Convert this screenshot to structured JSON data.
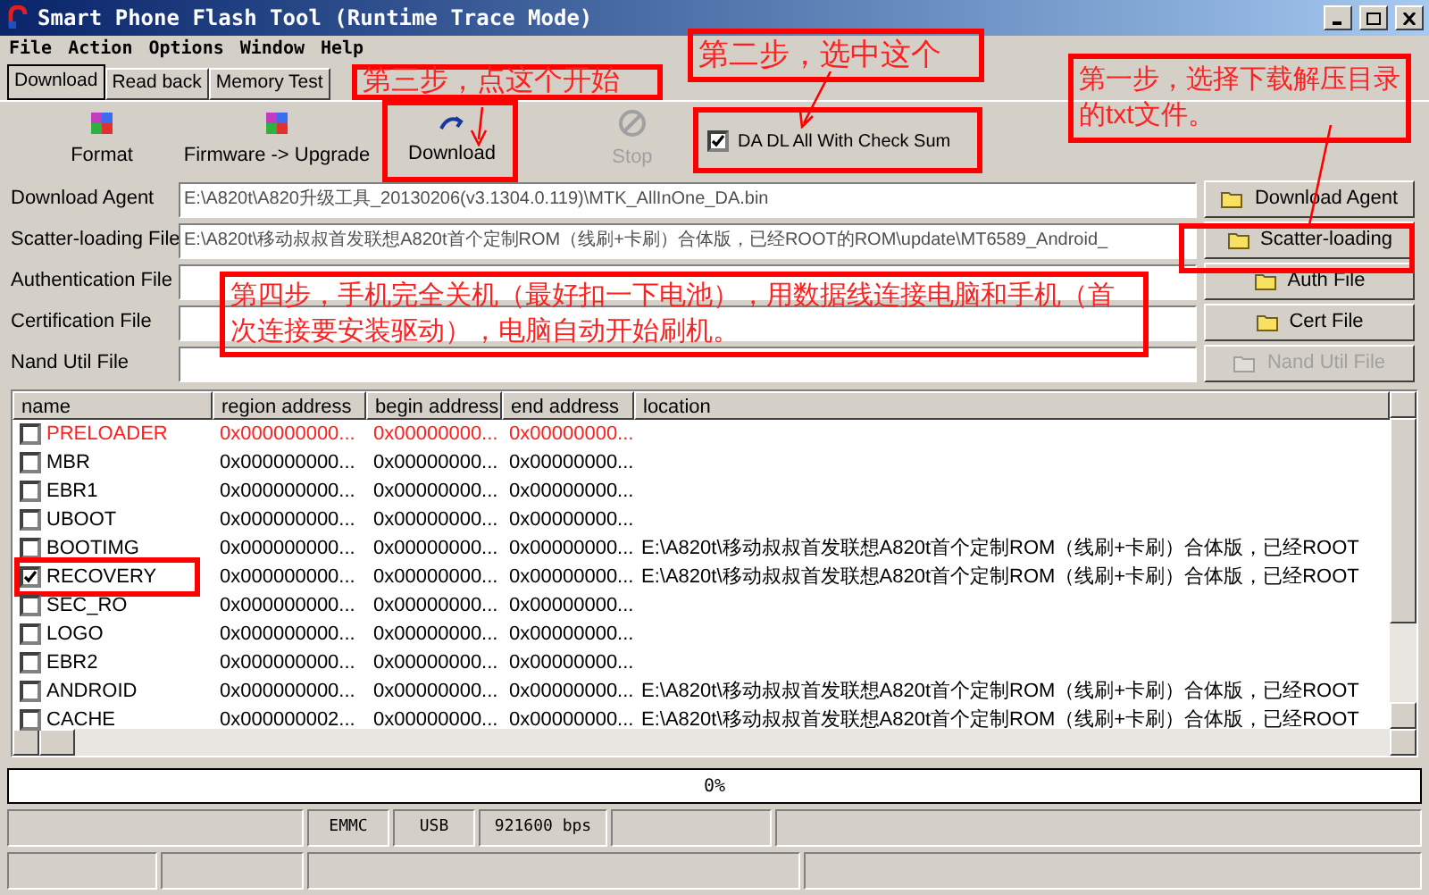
{
  "window": {
    "title": "Smart Phone Flash Tool (Runtime Trace Mode)"
  },
  "menu": [
    "File",
    "Action",
    "Options",
    "Window",
    "Help"
  ],
  "tabs": [
    {
      "label": "Download",
      "selected": true
    },
    {
      "label": "Read back",
      "selected": false
    },
    {
      "label": "Memory Test",
      "selected": false
    }
  ],
  "toolbar": [
    {
      "label": "Format",
      "kind": "format",
      "disabled": false
    },
    {
      "label": "Firmware -> Upgrade",
      "kind": "format",
      "disabled": false
    },
    {
      "label": "Download",
      "kind": "download",
      "disabled": false
    },
    {
      "label": "Stop",
      "kind": "stop",
      "disabled": true
    }
  ],
  "check_sum": {
    "label": "DA DL All With Check Sum",
    "checked": true
  },
  "files": [
    {
      "label": "Download Agent",
      "value": "E:\\A820t\\A820升级工具_20130206(v3.1304.0.119)\\MTK_AllInOne_DA.bin",
      "button": "Download Agent",
      "disabled": false
    },
    {
      "label": "Scatter-loading File",
      "value": "E:\\A820t\\移动叔叔首发联想A820t首个定制ROM（线刷+卡刷）合体版，已经ROOT的ROM\\update\\MT6589_Android_",
      "button": "Scatter-loading",
      "disabled": false
    },
    {
      "label": "Authentication File",
      "button": "Auth File",
      "disabled": false
    },
    {
      "label": "Certification File",
      "button": "Cert File",
      "disabled": false
    },
    {
      "label": "Nand Util File",
      "button": "Nand Util File",
      "disabled": true
    }
  ],
  "table": {
    "columns": [
      "name",
      "region address",
      "begin address",
      "end address",
      "location"
    ],
    "rows": [
      {
        "name": "PRELOADER",
        "checked": false,
        "error": true,
        "region": "0x000000000...",
        "begin": "0x00000000...",
        "end": "0x00000000..."
      },
      {
        "name": "MBR",
        "checked": false,
        "error": false,
        "region": "0x000000000...",
        "begin": "0x00000000...",
        "end": "0x00000000..."
      },
      {
        "name": "EBR1",
        "checked": false,
        "error": false,
        "region": "0x000000000...",
        "begin": "0x00000000...",
        "end": "0x00000000..."
      },
      {
        "name": "UBOOT",
        "checked": false,
        "error": false,
        "region": "0x000000000...",
        "begin": "0x00000000...",
        "end": "0x00000000..."
      },
      {
        "name": "BOOTIMG",
        "checked": false,
        "error": false,
        "region": "0x000000000...",
        "begin": "0x00000000...",
        "end": "0x00000000...",
        "location": "E:\\A820t\\移动叔叔首发联想A820t首个定制ROM（线刷+卡刷）合体版，已经ROOT"
      },
      {
        "name": "RECOVERY",
        "checked": true,
        "error": false,
        "annotated": true,
        "region": "0x000000000...",
        "begin": "0x00000000...",
        "end": "0x00000000...",
        "location": "E:\\A820t\\移动叔叔首发联想A820t首个定制ROM（线刷+卡刷）合体版，已经ROOT"
      },
      {
        "name": "SEC_RO",
        "checked": false,
        "error": false,
        "region": "0x000000000...",
        "begin": "0x00000000...",
        "end": "0x00000000..."
      },
      {
        "name": "LOGO",
        "checked": false,
        "error": false,
        "region": "0x000000000...",
        "begin": "0x00000000...",
        "end": "0x00000000..."
      },
      {
        "name": "EBR2",
        "checked": false,
        "error": false,
        "region": "0x000000000...",
        "begin": "0x00000000...",
        "end": "0x00000000..."
      },
      {
        "name": "ANDROID",
        "checked": false,
        "error": false,
        "region": "0x000000000...",
        "begin": "0x00000000...",
        "end": "0x00000000...",
        "location": "E:\\A820t\\移动叔叔首发联想A820t首个定制ROM（线刷+卡刷）合体版，已经ROOT"
      },
      {
        "name": "CACHE",
        "checked": false,
        "error": false,
        "region": "0x000000002...",
        "begin": "0x00000000...",
        "end": "0x00000000...",
        "location": "E:\\A820t\\移动叔叔首发联想A820t首个定制ROM（线刷+卡刷）合体版，已经ROOT"
      }
    ]
  },
  "progress": {
    "text": "0%",
    "level": 0
  },
  "status_bar": [
    "EMMC",
    "USB",
    "921600 bps"
  ],
  "annotations": [
    "第三步，点这个开始",
    "第二步，选中这个",
    "第一步，选择下载解压目录的txt文件。",
    "第四步，手机完全关机（最好扣一下电池），用数据线连接电脑和手机（首次连接要安装驱动），电脑自动开始刷机。"
  ]
}
